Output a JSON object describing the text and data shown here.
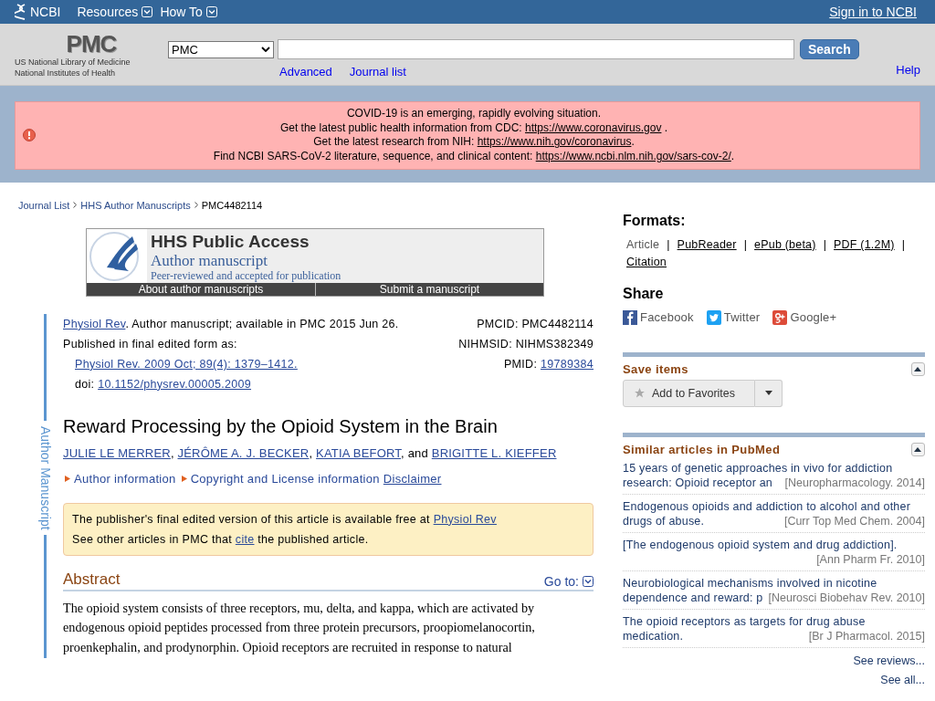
{
  "topbar": {
    "logo": "NCBI",
    "menus": [
      "Resources",
      "How To"
    ],
    "signin": "Sign in to NCBI"
  },
  "searchbar": {
    "logo": "PMC",
    "org": [
      "US National Library of Medicine",
      "National Institutes of Health"
    ],
    "database": "PMC",
    "button": "Search",
    "links": [
      "Advanced",
      "Journal list"
    ],
    "help": "Help"
  },
  "alert": {
    "lines": [
      {
        "text": "COVID-19 is an emerging, rapidly evolving situation."
      },
      {
        "text": "Get the latest public health information from CDC: ",
        "link": "https://www.coronavirus.gov",
        "after": " ."
      },
      {
        "text": "Get the latest research from NIH: ",
        "link": "https://www.nih.gov/coronavirus",
        "after": "."
      },
      {
        "text": "Find NCBI SARS-CoV-2 literature, sequence, and clinical content: ",
        "link": "https://www.ncbi.nlm.nih.gov/sars-cov-2/",
        "after": "."
      }
    ]
  },
  "breadcrumb": {
    "links": [
      "Journal List",
      "HHS Author Manuscripts"
    ],
    "current": "PMC4482114"
  },
  "banner": {
    "title": "HHS Public Access",
    "subtitle": "Author manuscript",
    "note": "Peer-reviewed and accepted for publication",
    "buttons": [
      "About author manuscripts",
      "Submit a manuscript"
    ]
  },
  "side_label": "Author Manuscript",
  "citation": {
    "journal": "Physiol Rev",
    "availability": ". Author manuscript; available in PMC 2015 Jun 26.",
    "published": "Published in final edited form as:",
    "reference": "Physiol Rev. 2009 Oct; 89(4): 1379–1412.",
    "doi_label": "doi: ",
    "doi": "10.1152/physrev.00005.2009",
    "ids": [
      {
        "label": "PMCID: ",
        "value": "PMC4482114",
        "link": false
      },
      {
        "label": "NIHMSID: ",
        "value": "NIHMS382349",
        "link": false
      },
      {
        "label": "PMID: ",
        "value": "19789384",
        "link": true
      }
    ]
  },
  "article": {
    "title": "Reward Processing by the Opioid System in the Brain",
    "authors": [
      {
        "name": "JULIE LE MERRER",
        "sep": ","
      },
      {
        "name": "JÉRÔME A. J. BECKER",
        "sep": ","
      },
      {
        "name": "KATIA BEFORT",
        "sep": ", and"
      },
      {
        "name": "BRIGITTE L. KIEFFER"
      }
    ],
    "info": [
      "Author information",
      "Copyright and License information"
    ],
    "disclaimer": "Disclaimer"
  },
  "notice": {
    "lines": [
      {
        "text": "The publisher's final edited version of this article is available free at ",
        "link": "Physiol Rev"
      },
      {
        "text": "See other articles in PMC that ",
        "link": "cite",
        "after": " the published article."
      }
    ]
  },
  "abstract": {
    "heading": "Abstract",
    "goto": "Go to:",
    "text": "The opioid system consists of three receptors, mu, delta, and kappa, which are activated by endogenous opioid peptides processed from three protein precursors, proopiomelanocortin, proenkephalin, and prodynorphin. Opioid receptors are recruited in response to natural"
  },
  "formats": {
    "heading": "Formats:",
    "separator": "|",
    "items": [
      {
        "label": "Article",
        "selected": true
      },
      {
        "label": "PubReader",
        "selected": false
      },
      {
        "label": "ePub (beta)",
        "selected": false
      },
      {
        "label": "PDF (1.2M)",
        "selected": false
      },
      {
        "label": "Citation",
        "selected": false
      }
    ]
  },
  "share": {
    "heading": "Share",
    "items": [
      {
        "label": "Facebook",
        "kind": "facebook"
      },
      {
        "label": "Twitter",
        "kind": "twitter"
      },
      {
        "label": "Google+",
        "kind": "google"
      }
    ]
  },
  "save_items": {
    "heading": "Save items",
    "button": "Add to Favorites"
  },
  "similar": {
    "heading": "Similar articles in PubMed",
    "items": [
      {
        "title": [
          "15 years of genetic approaches in vivo for addiction",
          "research: Opioid receptor an"
        ],
        "source": "[Neuropharmacology. 2014]"
      },
      {
        "title": [
          "Endogenous opioids and addiction to alcohol and other",
          "drugs of abuse."
        ],
        "source": "[Curr Top Med Chem. 2004]"
      },
      {
        "title": [
          "[The endogenous opioid system and drug addiction]."
        ],
        "source": "[Ann Pharm Fr. 2010]"
      },
      {
        "title": [
          "Neurobiological mechanisms involved in nicotine",
          "dependence and reward: p"
        ],
        "source": "[Neurosci Biobehav Rev. 2010]"
      },
      {
        "title": [
          "The opioid receptors as targets for drug abuse",
          "medication."
        ],
        "source": "[Br J Pharmacol. 2015]"
      }
    ],
    "more": [
      "See reviews...",
      "See all..."
    ]
  }
}
